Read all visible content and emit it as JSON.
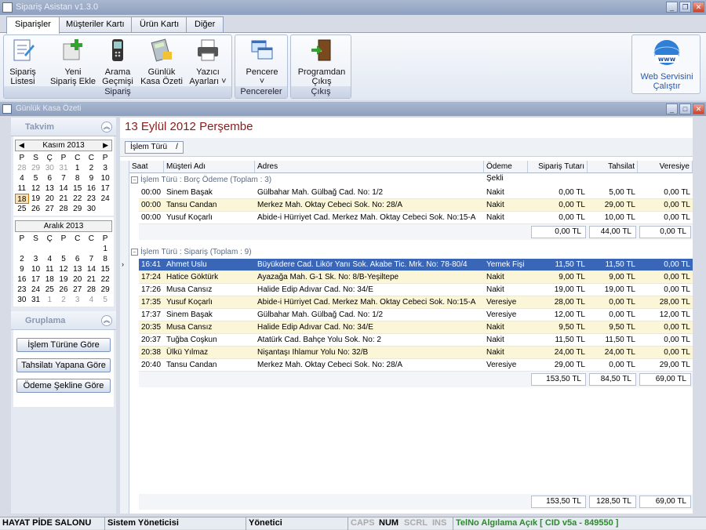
{
  "app_title": "Sipariş Asistan v1.3.0",
  "ribbon_tabs": [
    "Siparişler",
    "Müşteriler Kartı",
    "Ürün Kartı",
    "Diğer"
  ],
  "ribbon": {
    "groups": [
      {
        "label": "Sipariş",
        "buttons": [
          {
            "line1": "Sipariş",
            "line2": "Listesi",
            "icon": "order-list-icon"
          },
          {
            "line1": "Yeni",
            "line2": "Sipariş Ekle",
            "icon": "add-order-icon"
          },
          {
            "line1": "Arama",
            "line2": "Geçmişi",
            "icon": "phone-icon"
          },
          {
            "line1": "Günlük",
            "line2": "Kasa Özeti",
            "icon": "calculator-icon"
          },
          {
            "line1": "Yazıcı",
            "line2": "Ayarları ˅",
            "icon": "printer-icon"
          }
        ]
      },
      {
        "label": "Pencereler",
        "buttons": [
          {
            "line1": "Pencere",
            "line2": "˅",
            "icon": "windows-icon"
          }
        ]
      },
      {
        "label": "Çıkış",
        "buttons": [
          {
            "line1": "Programdan",
            "line2": "Çıkış",
            "icon": "exit-door-icon"
          }
        ]
      }
    ],
    "web_service": {
      "line1": "Web Servisini",
      "line2": "Çalıştır",
      "icon": "www-globe-icon"
    }
  },
  "child_window_title": "Günlük Kasa Özeti",
  "left_panel": {
    "calendar_title": "Takvim",
    "calendar1": {
      "month": "Kasım 2013",
      "dow": [
        "P",
        "S",
        "Ç",
        "P",
        "C",
        "C",
        "P"
      ],
      "days": [
        "28",
        "29",
        "30",
        "31",
        "1",
        "2",
        "3",
        "4",
        "5",
        "6",
        "7",
        "8",
        "9",
        "10",
        "11",
        "12",
        "13",
        "14",
        "15",
        "16",
        "17",
        "18",
        "19",
        "20",
        "21",
        "22",
        "23",
        "24",
        "25",
        "26",
        "27",
        "28",
        "29",
        "30",
        ""
      ],
      "gray_indexes": [
        0,
        1,
        2,
        3
      ],
      "today_index": 21
    },
    "calendar2": {
      "month": "Aralık 2013",
      "dow": [
        "P",
        "S",
        "Ç",
        "P",
        "C",
        "C",
        "P"
      ],
      "days": [
        "",
        "",
        "",
        "",
        "",
        "",
        "1",
        "2",
        "3",
        "4",
        "5",
        "6",
        "7",
        "8",
        "9",
        "10",
        "11",
        "12",
        "13",
        "14",
        "15",
        "16",
        "17",
        "18",
        "19",
        "20",
        "21",
        "22",
        "23",
        "24",
        "25",
        "26",
        "27",
        "28",
        "29",
        "30",
        "31",
        "1",
        "2",
        "3",
        "4",
        "5"
      ],
      "gray_indexes": [
        37,
        38,
        39,
        40,
        41
      ]
    },
    "grouping_title": "Gruplama",
    "grouping_buttons": [
      "İşlem Türüne Göre",
      "Tahsilatı Yapana Göre",
      "Ödeme Şekline Göre"
    ]
  },
  "content": {
    "date_title": "13 Eylül 2012 Perşembe",
    "group_chip": "İşlem Türü",
    "columns": [
      "Saat",
      "Müşteri Adı",
      "Adres",
      "Ödeme Şekli",
      "Sipariş Tutarı",
      "Tahsilat",
      "Veresiye"
    ],
    "groups": [
      {
        "title": "İşlem Türü : Borç Ödeme (Toplam : 3)",
        "rows": [
          [
            "00:00",
            "Sinem Başak",
            "Gülbahar Mah. Gülbağ Cad. No: 1/2",
            "Nakit",
            "0,00 TL",
            "5,00 TL",
            "0,00 TL"
          ],
          [
            "00:00",
            "Tansu Candan",
            "Merkez Mah. Oktay Cebeci Sok. No: 28/A",
            "Nakit",
            "0,00 TL",
            "29,00 TL",
            "0,00 TL"
          ],
          [
            "00:00",
            "Yusuf Koçarlı",
            "Abide-i Hürriyet Cad. Merkez Mah. Oktay Cebeci Sok. No:15-A",
            "Nakit",
            "0,00 TL",
            "10,00 TL",
            "0,00 TL"
          ]
        ],
        "totals": [
          "0,00 TL",
          "44,00 TL",
          "0,00 TL"
        ]
      },
      {
        "title": "İşlem Türü : Sipariş (Toplam : 9)",
        "rows": [
          [
            "16:41",
            "Ahmet Uslu",
            "Büyükdere Cad. Likör Yanı Sok. Akabe Tic. Mrk. No: 78-80/4",
            "Yemek Fişi",
            "11,50 TL",
            "11,50 TL",
            "0,00 TL"
          ],
          [
            "17:24",
            "Hatice Göktürk",
            "Ayazağa Mah. G-1 Sk. No: 8/B-Yeşiltepe",
            "Nakit",
            "9,00 TL",
            "9,00 TL",
            "0,00 TL"
          ],
          [
            "17:26",
            "Musa Cansız",
            "Halide Edip Adıvar Cad. No: 34/E",
            "Nakit",
            "19,00 TL",
            "19,00 TL",
            "0,00 TL"
          ],
          [
            "17:35",
            "Yusuf Koçarlı",
            "Abide-i Hürriyet Cad. Merkez Mah. Oktay Cebeci Sok. No:15-A",
            "Veresiye",
            "28,00 TL",
            "0,00 TL",
            "28,00 TL"
          ],
          [
            "17:37",
            "Sinem Başak",
            "Gülbahar Mah. Gülbağ Cad. No: 1/2",
            "Veresiye",
            "12,00 TL",
            "0,00 TL",
            "12,00 TL"
          ],
          [
            "20:35",
            "Musa Cansız",
            "Halide Edip Adıvar Cad. No: 34/E",
            "Nakit",
            "9,50 TL",
            "9,50 TL",
            "0,00 TL"
          ],
          [
            "20:37",
            "Tuğba Coşkun",
            "Atatürk Cad. Bahçe Yolu Sok. No: 2",
            "Nakit",
            "11,50 TL",
            "11,50 TL",
            "0,00 TL"
          ],
          [
            "20:38",
            "Ülkü Yılmaz",
            "Nişantaşı Ihlamur Yolu No: 32/B",
            "Nakit",
            "24,00 TL",
            "24,00 TL",
            "0,00 TL"
          ],
          [
            "20:40",
            "Tansu Candan",
            "Merkez Mah. Oktay Cebeci Sok. No: 28/A",
            "Veresiye",
            "29,00 TL",
            "0,00 TL",
            "29,00 TL"
          ]
        ],
        "totals": [
          "153,50 TL",
          "84,50 TL",
          "69,00 TL"
        ]
      }
    ],
    "grand_totals": [
      "153,50 TL",
      "128,50 TL",
      "69,00 TL"
    ]
  },
  "status_bar": [
    "HAYAT PİDE SALONU",
    "Sistem Yöneticisi",
    "Yönetici",
    "CAPS",
    "NUM",
    "SCRL",
    "INS",
    "TelNo Algılama Açık [ CID v5a  - 849550 ]"
  ]
}
